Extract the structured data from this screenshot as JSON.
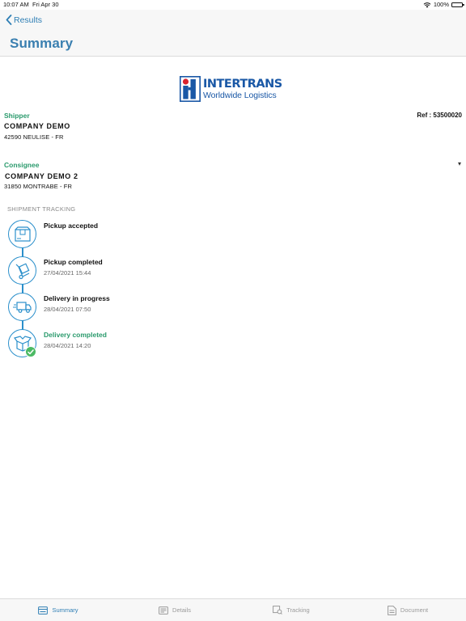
{
  "status_bar": {
    "time": "10:07 AM",
    "date": "Fri Apr 30",
    "battery": "100%",
    "icons": [
      "wifi-icon",
      "battery-icon"
    ]
  },
  "nav": {
    "back_label": "Results",
    "title": "Summary"
  },
  "logo": {
    "brand": "INTERTRANS",
    "tagline": "Worldwide Logistics"
  },
  "shipper": {
    "label": "Shipper",
    "company": "COMPANY DEMO",
    "address": "42590 NEULISE - FR"
  },
  "ref": "Ref : 53500020",
  "consignee": {
    "label": "Consignee",
    "company": "COMPANY DEMO 2",
    "address": "31850 MONTRABE - FR"
  },
  "tracking": {
    "header": "SHIPMENT TRACKING",
    "steps": [
      {
        "title": "Pickup accepted",
        "date": "",
        "icon": "package-icon"
      },
      {
        "title": "Pickup completed",
        "date": "27/04/2021 15:44",
        "icon": "hand-truck-icon"
      },
      {
        "title": "Delivery in progress",
        "date": "28/04/2021 07:50",
        "icon": "delivery-truck-icon"
      },
      {
        "title": "Delivery completed",
        "date": "28/04/2021 14:20",
        "icon": "open-box-icon"
      }
    ]
  },
  "tabs": [
    {
      "label": "Summary",
      "icon": "summary-icon",
      "active": true
    },
    {
      "label": "Details",
      "icon": "details-icon",
      "active": false
    },
    {
      "label": "Tracking",
      "icon": "tracking-icon",
      "active": false
    },
    {
      "label": "Document",
      "icon": "document-icon",
      "active": false
    }
  ],
  "colors": {
    "accent_blue": "#2a8fcb",
    "title_blue": "#3a7fb0",
    "green": "#2a9a6c",
    "check_green": "#4cba64",
    "brand_blue": "#1a58a6",
    "brand_red": "#d9232e"
  }
}
